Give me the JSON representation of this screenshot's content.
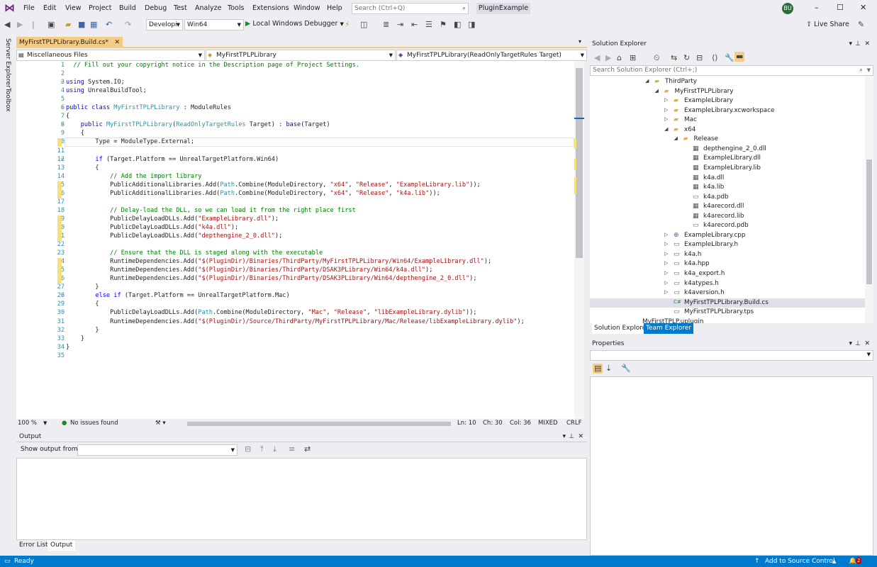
{
  "menu": [
    "File",
    "Edit",
    "View",
    "Project",
    "Build",
    "Debug",
    "Test",
    "Analyze",
    "Tools",
    "Extensions",
    "Window",
    "Help"
  ],
  "search": {
    "placeholder": "Search (Ctrl+Q)"
  },
  "solution_name": "PluginExample",
  "user_initials": "BU",
  "toolbar": {
    "config": "Developi",
    "platform": "Win64",
    "debugger": "Local Windows Debugger",
    "live_share": "Live Share"
  },
  "side_tabs": [
    "Server Explorer",
    "Toolbox"
  ],
  "doc_tab": {
    "label": "MyFirstTPLPLibrary.Build.cs*"
  },
  "nav": {
    "project": "Miscellaneous Files",
    "class": "MyFirstTPLPLibrary",
    "member": "MyFirstTPLPLibrary(ReadOnlyTargetRules Target)"
  },
  "code_lines": [
    "  // Fill out your copyright notice in the Description page of Project Settings.",
    "",
    "using System.IO;",
    "using UnrealBuildTool;",
    "",
    "public class MyFirstTPLPLibrary : ModuleRules",
    "{",
    "    public MyFirstTPLPLibrary(ReadOnlyTargetRules Target) : base(Target)",
    "    {",
    "        Type = ModuleType.External;",
    "",
    "        if (Target.Platform == UnrealTargetPlatform.Win64)",
    "        {",
    "            // Add the import library",
    "            PublicAdditionalLibraries.Add(Path.Combine(ModuleDirectory, \"x64\", \"Release\", \"ExampleLibrary.lib\"));",
    "            PublicAdditionalLibraries.Add(Path.Combine(ModuleDirectory, \"x64\", \"Release\", \"k4a.lib\"));",
    "",
    "            // Delay-load the DLL, so we can load it from the right place first",
    "            PublicDelayLoadDLLs.Add(\"ExampleLibrary.dll\");",
    "            PublicDelayLoadDLLs.Add(\"k4a.dll\");",
    "            PublicDelayLoadDLLs.Add(\"depthengine_2_0.dll\");",
    "",
    "            // Ensure that the DLL is staged along with the executable",
    "            RuntimeDependencies.Add(\"$(PluginDir)/Binaries/ThirdParty/MyFirstTPLPLibrary/Win64/ExampleLibrary.dll\");",
    "            RuntimeDependencies.Add(\"$(PluginDir)/Binaries/ThirdParty/DSAK3PLibrary/Win64/k4a.dll\");",
    "            RuntimeDependencies.Add(\"$(PluginDir)/Binaries/ThirdParty/DSAK3PLibrary/Win64/depthengine_2_0.dll\");",
    "        }",
    "        else if (Target.Platform == UnrealTargetPlatform.Mac)",
    "        {",
    "            PublicDelayLoadDLLs.Add(Path.Combine(ModuleDirectory, \"Mac\", \"Release\", \"libExampleLibrary.dylib\"));",
    "            RuntimeDependencies.Add(\"$(PluginDir)/Source/ThirdParty/MyFirstTPLPLibrary/Mac/Release/libExampleLibrary.dylib\");",
    "        }",
    "    }",
    "}",
    ""
  ],
  "editor_status": {
    "zoom": "100 %",
    "issues": "No issues found",
    "ln": "Ln: 10",
    "ch": "Ch: 30",
    "col": "Col: 36",
    "mixed": "MIXED",
    "crlf": "CRLF"
  },
  "output": {
    "title": "Output",
    "show_from": "Show output from:"
  },
  "bottom_tabs": [
    "Error List",
    "Output"
  ],
  "solution_explorer": {
    "title": "Solution Explorer",
    "search_placeholder": "Search Solution Explorer (Ctrl+;)",
    "tree": [
      {
        "label": "ThirdParty",
        "depth": 0,
        "icon": "folder"
      },
      {
        "label": "MyFirstTPLPLibrary",
        "depth": 1,
        "icon": "folder"
      },
      {
        "label": "ExampleLibrary",
        "depth": 2,
        "icon": "folder"
      },
      {
        "label": "ExampleLibrary.xcworkspace",
        "depth": 2,
        "icon": "folder"
      },
      {
        "label": "Mac",
        "depth": 2,
        "icon": "folder"
      },
      {
        "label": "x64",
        "depth": 2,
        "icon": "folder"
      },
      {
        "label": "Release",
        "depth": 3,
        "icon": "folder"
      },
      {
        "label": "depthengine_2_0.dll",
        "depth": 4,
        "icon": "binary"
      },
      {
        "label": "ExampleLibrary.dll",
        "depth": 4,
        "icon": "binary"
      },
      {
        "label": "ExampleLibrary.lib",
        "depth": 4,
        "icon": "binary"
      },
      {
        "label": "k4a.dll",
        "depth": 4,
        "icon": "binary"
      },
      {
        "label": "k4a.lib",
        "depth": 4,
        "icon": "binary"
      },
      {
        "label": "k4a.pdb",
        "depth": 4,
        "icon": "file"
      },
      {
        "label": "k4arecord.dll",
        "depth": 4,
        "icon": "binary"
      },
      {
        "label": "k4arecord.lib",
        "depth": 4,
        "icon": "binary"
      },
      {
        "label": "k4arecord.pdb",
        "depth": 4,
        "icon": "file"
      },
      {
        "label": "ExampleLibrary.cpp",
        "depth": 2,
        "icon": "cpp"
      },
      {
        "label": "ExampleLibrary.h",
        "depth": 2,
        "icon": "file"
      },
      {
        "label": "k4a.h",
        "depth": 2,
        "icon": "file"
      },
      {
        "label": "k4a.hpp",
        "depth": 2,
        "icon": "file"
      },
      {
        "label": "k4a_export.h",
        "depth": 2,
        "icon": "file"
      },
      {
        "label": "k4atypes.h",
        "depth": 2,
        "icon": "file"
      },
      {
        "label": "k4aversion.h",
        "depth": 2,
        "icon": "file"
      },
      {
        "label": "MyFirstTPLPLibrary.Build.cs",
        "depth": 2,
        "icon": "cs"
      },
      {
        "label": "MyFirstTPLPLibrary.tps",
        "depth": 2,
        "icon": "file"
      },
      {
        "label": "MyFirstTPLP.uplugin",
        "depth": 0,
        "icon": "file"
      }
    ],
    "tabs": [
      "Solution Explorer",
      "Team Explorer"
    ]
  },
  "properties": {
    "title": "Properties"
  },
  "statusbar": {
    "ready": "Ready",
    "source_control": "Add to Source Control",
    "notifications": "2"
  }
}
